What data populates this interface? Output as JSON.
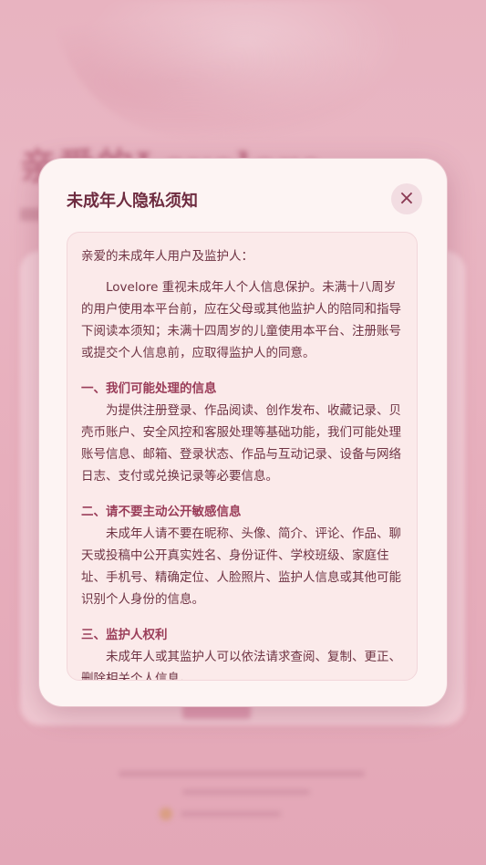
{
  "background": {
    "title_text": "亲爱的Lovelore"
  },
  "modal": {
    "title": "未成年人隐私须知",
    "close_icon": "×",
    "greeting": "亲爱的未成年人用户及监护人：",
    "intro": "Lovelore 重视未成年人个人信息保护。未满十八周岁的用户使用本平台前，应在父母或其他监护人的陪同和指导下阅读本须知；未满十四周岁的儿童使用本平台、注册账号或提交个人信息前，应取得监护人的同意。",
    "sections": [
      {
        "title": "一、我们可能处理的信息",
        "body": "为提供注册登录、作品阅读、创作发布、收藏记录、贝壳币账户、安全风控和客服处理等基础功能，我们可能处理账号信息、邮箱、登录状态、作品与互动记录、设备与网络日志、支付或兑换记录等必要信息。"
      },
      {
        "title": "二、请不要主动公开敏感信息",
        "body": "未成年人请不要在昵称、头像、简介、评论、作品、聊天或投稿中公开真实姓名、身份证件、学校班级、家庭住址、手机号、精确定位、人脸照片、监护人信息或其他可能识别个人身份的信息。"
      },
      {
        "title": "三、监护人权利",
        "body": "未成年人或其监护人可以依法请求查阅、复制、更正、删除相关个人信息。"
      }
    ]
  },
  "colors": {
    "accent": "#9a3d59",
    "text": "#6e3343",
    "modal_bg": "#fdf4f3",
    "content_bg": "#fbeaea"
  }
}
